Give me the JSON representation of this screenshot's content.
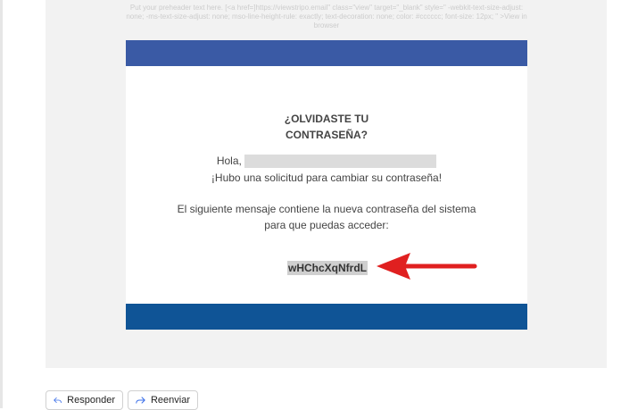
{
  "preheader": "Put your preheader text here. [<a href=]https://viewstripo.email\" class=\"view\" target=\"_blank\" style=\" -webkit-text-size-adjust: none; -ms-text-size-adjust: none; mso-line-height-rule: exactly; text-decoration: none; color: #cccccc; font-size: 12px; \" >View in browser",
  "email": {
    "title_line1": "¿OLVIDASTE TU",
    "title_line2": "CONTRASEÑA?",
    "greeting": "Hola,",
    "line_request": "¡Hubo una solicitud para cambiar su contraseña!",
    "line_message_1": "El siguiente mensaje contiene la nueva contraseña del sistema",
    "line_message_2": "para que puedas acceder:",
    "password": "wHChcXqNfrdL"
  },
  "actions": {
    "reply_label": "Responder",
    "forward_label": "Reenviar"
  },
  "colors": {
    "top_band": "#3a5aa5",
    "bottom_band": "#0f5496",
    "arrow": "#e02020",
    "action_icon": "#3a6ee8"
  }
}
